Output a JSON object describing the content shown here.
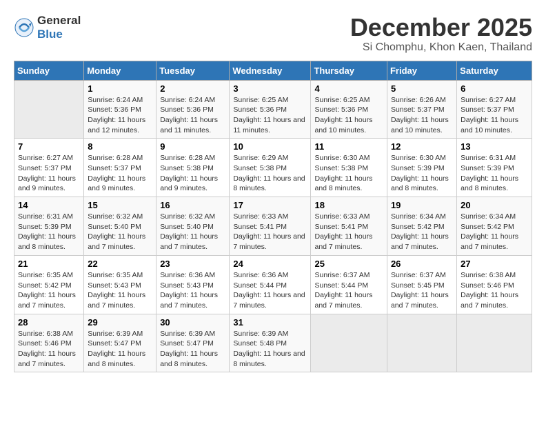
{
  "header": {
    "logo_line1": "General",
    "logo_line2": "Blue",
    "month_title": "December 2025",
    "location": "Si Chomphu, Khon Kaen, Thailand"
  },
  "days_of_week": [
    "Sunday",
    "Monday",
    "Tuesday",
    "Wednesday",
    "Thursday",
    "Friday",
    "Saturday"
  ],
  "weeks": [
    [
      {
        "day": "",
        "sunrise": "",
        "sunset": "",
        "daylight": "",
        "empty": true
      },
      {
        "day": "1",
        "sunrise": "Sunrise: 6:24 AM",
        "sunset": "Sunset: 5:36 PM",
        "daylight": "Daylight: 11 hours and 12 minutes."
      },
      {
        "day": "2",
        "sunrise": "Sunrise: 6:24 AM",
        "sunset": "Sunset: 5:36 PM",
        "daylight": "Daylight: 11 hours and 11 minutes."
      },
      {
        "day": "3",
        "sunrise": "Sunrise: 6:25 AM",
        "sunset": "Sunset: 5:36 PM",
        "daylight": "Daylight: 11 hours and 11 minutes."
      },
      {
        "day": "4",
        "sunrise": "Sunrise: 6:25 AM",
        "sunset": "Sunset: 5:36 PM",
        "daylight": "Daylight: 11 hours and 10 minutes."
      },
      {
        "day": "5",
        "sunrise": "Sunrise: 6:26 AM",
        "sunset": "Sunset: 5:37 PM",
        "daylight": "Daylight: 11 hours and 10 minutes."
      },
      {
        "day": "6",
        "sunrise": "Sunrise: 6:27 AM",
        "sunset": "Sunset: 5:37 PM",
        "daylight": "Daylight: 11 hours and 10 minutes."
      }
    ],
    [
      {
        "day": "7",
        "sunrise": "Sunrise: 6:27 AM",
        "sunset": "Sunset: 5:37 PM",
        "daylight": "Daylight: 11 hours and 9 minutes."
      },
      {
        "day": "8",
        "sunrise": "Sunrise: 6:28 AM",
        "sunset": "Sunset: 5:37 PM",
        "daylight": "Daylight: 11 hours and 9 minutes."
      },
      {
        "day": "9",
        "sunrise": "Sunrise: 6:28 AM",
        "sunset": "Sunset: 5:38 PM",
        "daylight": "Daylight: 11 hours and 9 minutes."
      },
      {
        "day": "10",
        "sunrise": "Sunrise: 6:29 AM",
        "sunset": "Sunset: 5:38 PM",
        "daylight": "Daylight: 11 hours and 8 minutes."
      },
      {
        "day": "11",
        "sunrise": "Sunrise: 6:30 AM",
        "sunset": "Sunset: 5:38 PM",
        "daylight": "Daylight: 11 hours and 8 minutes."
      },
      {
        "day": "12",
        "sunrise": "Sunrise: 6:30 AM",
        "sunset": "Sunset: 5:39 PM",
        "daylight": "Daylight: 11 hours and 8 minutes."
      },
      {
        "day": "13",
        "sunrise": "Sunrise: 6:31 AM",
        "sunset": "Sunset: 5:39 PM",
        "daylight": "Daylight: 11 hours and 8 minutes."
      }
    ],
    [
      {
        "day": "14",
        "sunrise": "Sunrise: 6:31 AM",
        "sunset": "Sunset: 5:39 PM",
        "daylight": "Daylight: 11 hours and 8 minutes."
      },
      {
        "day": "15",
        "sunrise": "Sunrise: 6:32 AM",
        "sunset": "Sunset: 5:40 PM",
        "daylight": "Daylight: 11 hours and 7 minutes."
      },
      {
        "day": "16",
        "sunrise": "Sunrise: 6:32 AM",
        "sunset": "Sunset: 5:40 PM",
        "daylight": "Daylight: 11 hours and 7 minutes."
      },
      {
        "day": "17",
        "sunrise": "Sunrise: 6:33 AM",
        "sunset": "Sunset: 5:41 PM",
        "daylight": "Daylight: 11 hours and 7 minutes."
      },
      {
        "day": "18",
        "sunrise": "Sunrise: 6:33 AM",
        "sunset": "Sunset: 5:41 PM",
        "daylight": "Daylight: 11 hours and 7 minutes."
      },
      {
        "day": "19",
        "sunrise": "Sunrise: 6:34 AM",
        "sunset": "Sunset: 5:42 PM",
        "daylight": "Daylight: 11 hours and 7 minutes."
      },
      {
        "day": "20",
        "sunrise": "Sunrise: 6:34 AM",
        "sunset": "Sunset: 5:42 PM",
        "daylight": "Daylight: 11 hours and 7 minutes."
      }
    ],
    [
      {
        "day": "21",
        "sunrise": "Sunrise: 6:35 AM",
        "sunset": "Sunset: 5:42 PM",
        "daylight": "Daylight: 11 hours and 7 minutes."
      },
      {
        "day": "22",
        "sunrise": "Sunrise: 6:35 AM",
        "sunset": "Sunset: 5:43 PM",
        "daylight": "Daylight: 11 hours and 7 minutes."
      },
      {
        "day": "23",
        "sunrise": "Sunrise: 6:36 AM",
        "sunset": "Sunset: 5:43 PM",
        "daylight": "Daylight: 11 hours and 7 minutes."
      },
      {
        "day": "24",
        "sunrise": "Sunrise: 6:36 AM",
        "sunset": "Sunset: 5:44 PM",
        "daylight": "Daylight: 11 hours and 7 minutes."
      },
      {
        "day": "25",
        "sunrise": "Sunrise: 6:37 AM",
        "sunset": "Sunset: 5:44 PM",
        "daylight": "Daylight: 11 hours and 7 minutes."
      },
      {
        "day": "26",
        "sunrise": "Sunrise: 6:37 AM",
        "sunset": "Sunset: 5:45 PM",
        "daylight": "Daylight: 11 hours and 7 minutes."
      },
      {
        "day": "27",
        "sunrise": "Sunrise: 6:38 AM",
        "sunset": "Sunset: 5:46 PM",
        "daylight": "Daylight: 11 hours and 7 minutes."
      }
    ],
    [
      {
        "day": "28",
        "sunrise": "Sunrise: 6:38 AM",
        "sunset": "Sunset: 5:46 PM",
        "daylight": "Daylight: 11 hours and 7 minutes."
      },
      {
        "day": "29",
        "sunrise": "Sunrise: 6:39 AM",
        "sunset": "Sunset: 5:47 PM",
        "daylight": "Daylight: 11 hours and 8 minutes."
      },
      {
        "day": "30",
        "sunrise": "Sunrise: 6:39 AM",
        "sunset": "Sunset: 5:47 PM",
        "daylight": "Daylight: 11 hours and 8 minutes."
      },
      {
        "day": "31",
        "sunrise": "Sunrise: 6:39 AM",
        "sunset": "Sunset: 5:48 PM",
        "daylight": "Daylight: 11 hours and 8 minutes."
      },
      {
        "day": "",
        "sunrise": "",
        "sunset": "",
        "daylight": "",
        "empty": true
      },
      {
        "day": "",
        "sunrise": "",
        "sunset": "",
        "daylight": "",
        "empty": true
      },
      {
        "day": "",
        "sunrise": "",
        "sunset": "",
        "daylight": "",
        "empty": true
      }
    ]
  ]
}
